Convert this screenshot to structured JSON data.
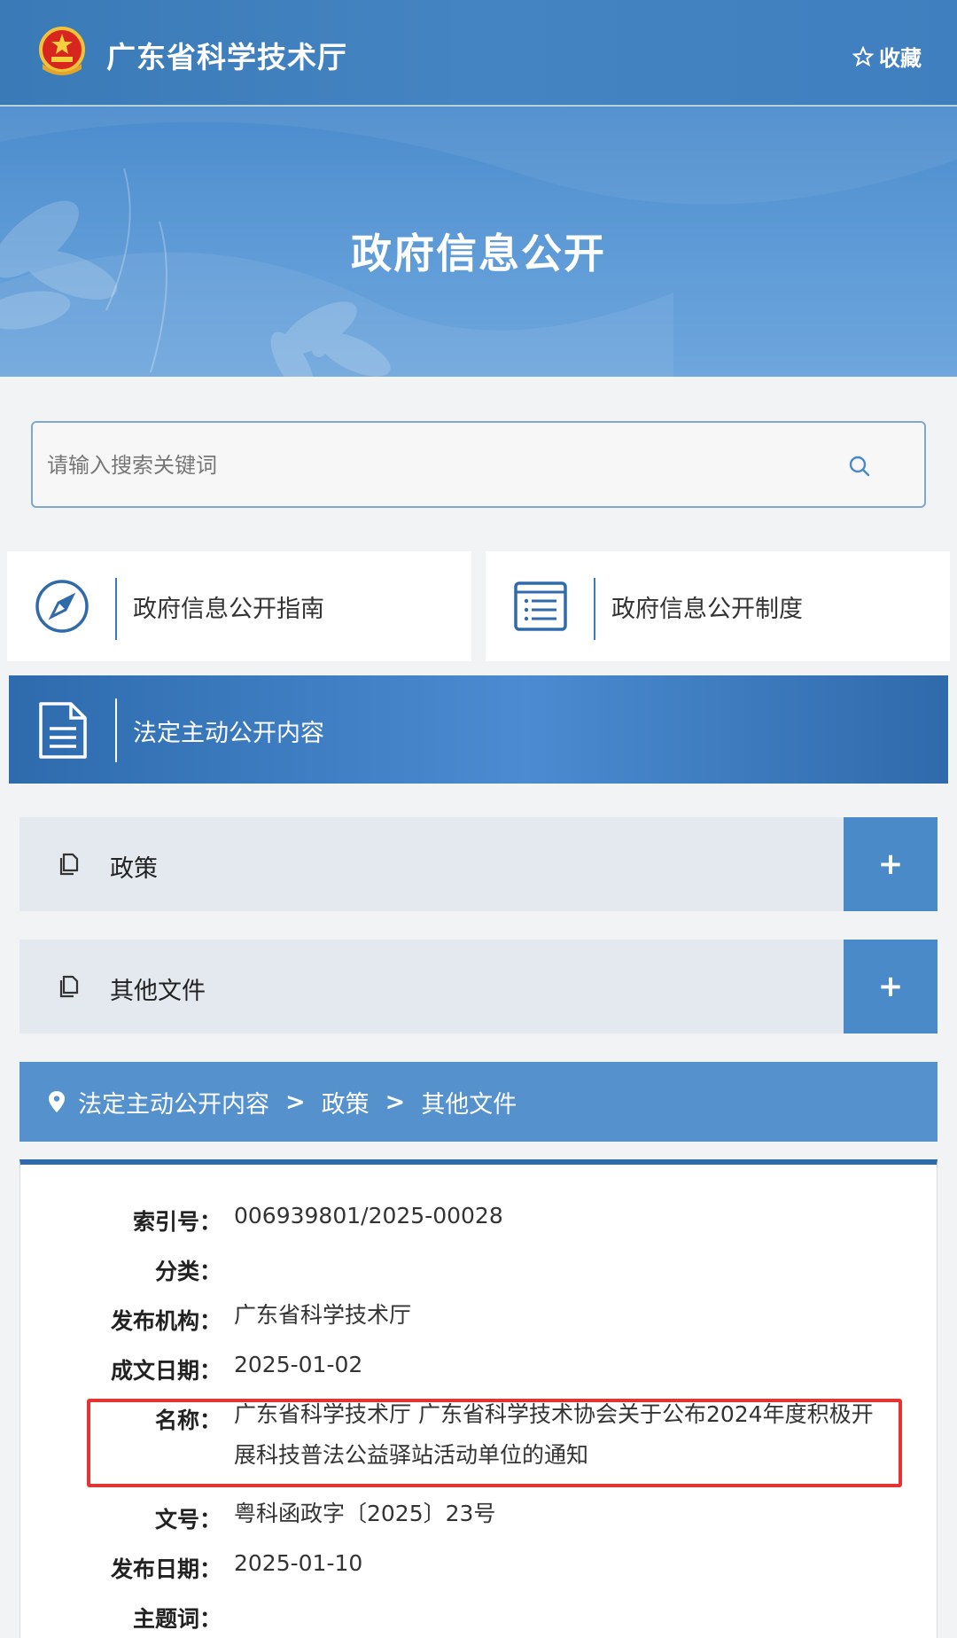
{
  "header": {
    "title": "广东省科学技术厅",
    "favorite_label": "收藏",
    "emblem_icon": "national-emblem-icon"
  },
  "banner": {
    "title": "政府信息公开"
  },
  "search": {
    "placeholder": "请输入搜索关键词"
  },
  "nav_cards": [
    {
      "label": "政府信息公开指南",
      "icon": "compass-icon"
    },
    {
      "label": "政府信息公开制度",
      "icon": "list-icon"
    }
  ],
  "active_section": {
    "label": "法定主动公开内容",
    "icon": "document-icon"
  },
  "accordion": [
    {
      "label": "政策",
      "toggle": "+"
    },
    {
      "label": "其他文件",
      "toggle": "+"
    }
  ],
  "breadcrumb": {
    "items": [
      "法定主动公开内容",
      "政策",
      "其他文件"
    ],
    "separator": ">"
  },
  "detail": {
    "rows": [
      {
        "key": "索引号：",
        "value": "006939801/2025-00028"
      },
      {
        "key": "分类：",
        "value": ""
      },
      {
        "key": "发布机构：",
        "value": "广东省科学技术厅"
      },
      {
        "key": "成文日期：",
        "value": "2025-01-02"
      },
      {
        "key": "名称：",
        "value": "广东省科学技术厅 广东省科学技术协会关于公布2024年度积极开展科技普法公益驿站活动单位的通知"
      },
      {
        "key": "文号：",
        "value": "粤科函政字〔2025〕23号"
      },
      {
        "key": "发布日期：",
        "value": "2025-01-10"
      },
      {
        "key": "主题词：",
        "value": ""
      }
    ]
  },
  "colors": {
    "header": "#4584c2",
    "accent": "#2f6aab",
    "highlight": "#e53232"
  }
}
